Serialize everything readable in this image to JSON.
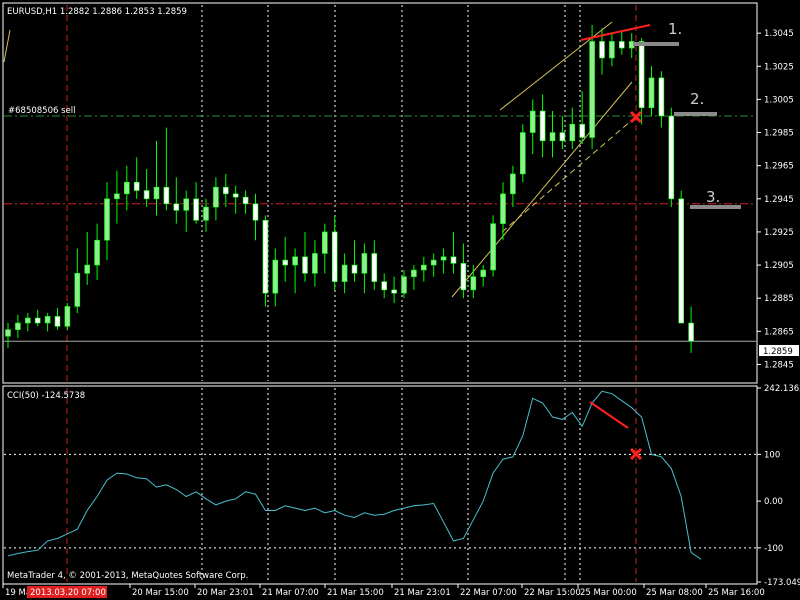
{
  "header": {
    "symbol_label": "EURUSD,H1  1.2882 1.2886 1.2853 1.2859",
    "order_label": "#68508506 sell",
    "current_price": "1.2859",
    "copyright": "MetaTrader 4, © 2001-2013, MetaQuotes Software Corp.",
    "highlighted_time": "2013.03.20 07:00"
  },
  "annotations": {
    "tag1": "1.",
    "tag2": "2.",
    "tag3": "3."
  },
  "colors": {
    "background": "#000000",
    "grid": "#ffffff",
    "bull_candle": "#90EE90",
    "bear_candle": "#ffffff",
    "wick": "#00ff00",
    "cci_line": "#48c0d0",
    "trend": "#d4c35a",
    "red": "#ff2020",
    "order_line": "#2e8b2e",
    "level_red": "#d02020",
    "marker": "#8a8a8a"
  },
  "chart_data": [
    {
      "type": "candlestick",
      "title": "EURUSD,H1  1.2882 1.2886 1.2853 1.2859",
      "ylim": [
        1.2835,
        1.3062
      ],
      "y_ticks": [
        "1.3045",
        "1.3025",
        "1.3005",
        "1.2985",
        "1.2965",
        "1.2945",
        "1.2925",
        "1.2905",
        "1.2885",
        "1.2865",
        "1.2845"
      ],
      "x_ticks": [
        "19 Mar 2013",
        "20 Mar 15:00",
        "20 Mar 23:01",
        "21 Mar 07:00",
        "21 Mar 15:00",
        "21 Mar 23:01",
        "22 Mar 07:00",
        "22 Mar 15:00",
        "25 Mar 00:00",
        "25 Mar 08:00",
        "25 Mar 16:00"
      ],
      "order_price": 1.2995,
      "level_price": 1.2942,
      "price_line": 1.2859,
      "ohlc": [
        [
          1.2862,
          1.287,
          1.2855,
          1.2866
        ],
        [
          1.2866,
          1.2875,
          1.2861,
          1.287
        ],
        [
          1.287,
          1.2876,
          1.2865,
          1.2873
        ],
        [
          1.2873,
          1.2878,
          1.2868,
          1.287
        ],
        [
          1.287,
          1.2876,
          1.2865,
          1.2874
        ],
        [
          1.2874,
          1.2879,
          1.2866,
          1.2868
        ],
        [
          1.2868,
          1.2882,
          1.2866,
          1.288
        ],
        [
          1.288,
          1.2915,
          1.2876,
          1.29
        ],
        [
          1.29,
          1.2925,
          1.2893,
          1.2905
        ],
        [
          1.2905,
          1.293,
          1.2896,
          1.292
        ],
        [
          1.292,
          1.2955,
          1.2908,
          1.2945
        ],
        [
          1.2945,
          1.2962,
          1.293,
          1.2948
        ],
        [
          1.2948,
          1.2965,
          1.2938,
          1.2955
        ],
        [
          1.2955,
          1.297,
          1.2945,
          1.295
        ],
        [
          1.295,
          1.2963,
          1.294,
          1.2945
        ],
        [
          1.2945,
          1.298,
          1.2935,
          1.2952
        ],
        [
          1.2952,
          1.2988,
          1.2938,
          1.2942
        ],
        [
          1.2942,
          1.2958,
          1.293,
          1.2938
        ],
        [
          1.2938,
          1.295,
          1.2925,
          1.2945
        ],
        [
          1.2945,
          1.2955,
          1.293,
          1.2932
        ],
        [
          1.2932,
          1.2945,
          1.2925,
          1.294
        ],
        [
          1.294,
          1.2958,
          1.2932,
          1.2952
        ],
        [
          1.2952,
          1.296,
          1.294,
          1.2948
        ],
        [
          1.2948,
          1.2953,
          1.2936,
          1.2946
        ],
        [
          1.2946,
          1.295,
          1.2936,
          1.2942
        ],
        [
          1.2942,
          1.2948,
          1.292,
          1.2932
        ],
        [
          1.2932,
          1.2935,
          1.288,
          1.2888
        ],
        [
          1.2888,
          1.2915,
          1.288,
          1.2908
        ],
        [
          1.2908,
          1.2922,
          1.2895,
          1.2905
        ],
        [
          1.2905,
          1.2915,
          1.2888,
          1.291
        ],
        [
          1.291,
          1.2925,
          1.2895,
          1.29
        ],
        [
          1.29,
          1.292,
          1.2892,
          1.2912
        ],
        [
          1.2912,
          1.293,
          1.29,
          1.2925
        ],
        [
          1.2925,
          1.2935,
          1.289,
          1.2895
        ],
        [
          1.2895,
          1.2912,
          1.2888,
          1.2905
        ],
        [
          1.2905,
          1.292,
          1.2895,
          1.29
        ],
        [
          1.29,
          1.2918,
          1.2888,
          1.2912
        ],
        [
          1.2912,
          1.292,
          1.289,
          1.2895
        ],
        [
          1.2895,
          1.29,
          1.2885,
          1.289
        ],
        [
          1.289,
          1.2898,
          1.2882,
          1.2888
        ],
        [
          1.2888,
          1.2902,
          1.2885,
          1.2898
        ],
        [
          1.2898,
          1.2905,
          1.289,
          1.2902
        ],
        [
          1.2902,
          1.291,
          1.2895,
          1.2905
        ],
        [
          1.2905,
          1.2912,
          1.2898,
          1.2908
        ],
        [
          1.2908,
          1.2915,
          1.29,
          1.291
        ],
        [
          1.291,
          1.2925,
          1.29,
          1.2906
        ],
        [
          1.2906,
          1.2918,
          1.2885,
          1.289
        ],
        [
          1.289,
          1.2905,
          1.2885,
          1.2898
        ],
        [
          1.2898,
          1.2905,
          1.2892,
          1.2902
        ],
        [
          1.2902,
          1.2935,
          1.2898,
          1.293
        ],
        [
          1.293,
          1.2955,
          1.292,
          1.2948
        ],
        [
          1.2948,
          1.2965,
          1.294,
          1.296
        ],
        [
          1.296,
          1.299,
          1.2955,
          1.2985
        ],
        [
          1.2985,
          1.3005,
          1.2972,
          1.2998
        ],
        [
          1.2998,
          1.3008,
          1.297,
          1.298
        ],
        [
          1.298,
          1.2998,
          1.297,
          1.2985
        ],
        [
          1.2985,
          1.2995,
          1.2975,
          1.298
        ],
        [
          1.298,
          1.3,
          1.2975,
          1.299
        ],
        [
          1.299,
          1.301,
          1.2978,
          1.2982
        ],
        [
          1.2982,
          1.305,
          1.2975,
          1.304
        ],
        [
          1.304,
          1.3048,
          1.302,
          1.303
        ],
        [
          1.303,
          1.3045,
          1.3025,
          1.304
        ],
        [
          1.304,
          1.3046,
          1.3032,
          1.3036
        ],
        [
          1.3036,
          1.3045,
          1.303,
          1.304
        ],
        [
          1.304,
          1.3042,
          1.299,
          1.3
        ],
        [
          1.3,
          1.3025,
          1.2995,
          1.3018
        ],
        [
          1.3018,
          1.3022,
          1.2988,
          1.2995
        ],
        [
          1.2995,
          1.3,
          1.294,
          1.2945
        ],
        [
          1.2945,
          1.295,
          1.287,
          1.287
        ],
        [
          1.287,
          1.288,
          1.2852,
          1.2859
        ]
      ]
    },
    {
      "type": "line",
      "title": "CCI(50) -124.5738",
      "ylim": [
        -173.049,
        242.1363
      ],
      "y_ticks": [
        "242.1363",
        "100",
        "0.00",
        "-100",
        "-173.049"
      ],
      "levels": [
        100,
        -100
      ],
      "values": [
        -117,
        -112,
        -108,
        -105,
        -85,
        -80,
        -70,
        -60,
        -20,
        10,
        45,
        60,
        58,
        50,
        48,
        30,
        35,
        25,
        10,
        20,
        5,
        -8,
        0,
        5,
        20,
        15,
        -20,
        -20,
        -10,
        -15,
        -20,
        -15,
        -25,
        -20,
        -30,
        -35,
        -25,
        -30,
        -28,
        -20,
        -15,
        -10,
        -8,
        -5,
        -45,
        -85,
        -80,
        -40,
        0,
        60,
        90,
        95,
        140,
        220,
        210,
        180,
        175,
        190,
        160,
        210,
        235,
        230,
        215,
        200,
        180,
        100,
        95,
        70,
        10,
        -110,
        -124.5738
      ]
    }
  ]
}
